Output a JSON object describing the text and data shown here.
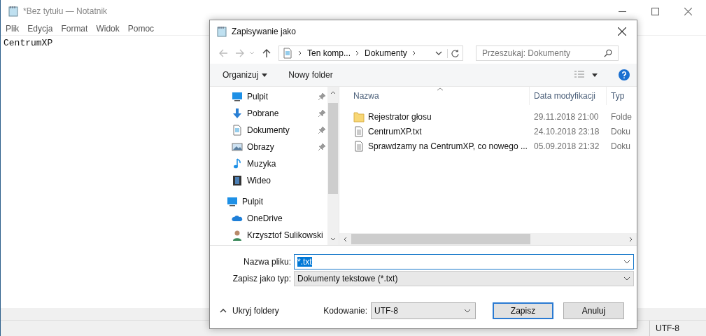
{
  "window": {
    "title": "*Bez tytułu — Notatnik"
  },
  "menu": [
    "Plik",
    "Edycja",
    "Format",
    "Widok",
    "Pomoc"
  ],
  "editor": {
    "text": "CentrumXP"
  },
  "status_bar": {
    "encoding": "UTF-8"
  },
  "dialog": {
    "title": "Zapisywanie jako",
    "breadcrumb": [
      "Ten komp...",
      "Dokumenty"
    ],
    "search": {
      "placeholder": "Przeszukaj: Dokumenty"
    },
    "toolbar": {
      "organize": "Organizuj",
      "new_folder": "Nowy folder"
    },
    "quick_access": [
      {
        "label": "Pulpit",
        "kind": "monitor",
        "pinned": true
      },
      {
        "label": "Pobrane",
        "kind": "download",
        "pinned": true
      },
      {
        "label": "Dokumenty",
        "kind": "document",
        "pinned": true
      },
      {
        "label": "Obrazy",
        "kind": "image",
        "pinned": true
      },
      {
        "label": "Muzyka",
        "kind": "music",
        "pinned": false
      },
      {
        "label": "Wideo",
        "kind": "video",
        "pinned": false
      }
    ],
    "locations": [
      {
        "label": "Pulpit",
        "kind": "monitor",
        "children": [
          {
            "label": "OneDrive",
            "kind": "cloud"
          },
          {
            "label": "Krzysztof Sulikowski",
            "kind": "user"
          }
        ]
      }
    ],
    "columns": [
      "Nazwa",
      "Data modyfikacji",
      "Typ"
    ],
    "files": [
      {
        "name": "Rejestrator głosu",
        "date": "29.11.2018 21:00",
        "type": "Folde",
        "kind": "folder"
      },
      {
        "name": "CentrumXP.txt",
        "date": "24.10.2018 23:18",
        "type": "Doku",
        "kind": "text"
      },
      {
        "name": "Sprawdzamy na CentrumXP, co nowego ...",
        "date": "05.09.2018 21:32",
        "type": "Doku",
        "kind": "text"
      }
    ],
    "filename": {
      "label": "Nazwa pliku:",
      "value": "*.txt"
    },
    "filetype": {
      "label": "Zapisz jako typ:",
      "value": "Dokumenty tekstowe (*.txt)"
    },
    "hide_folders": "Ukryj foldery",
    "encoding": {
      "label": "Kodowanie:",
      "value": "UTF-8"
    },
    "buttons": {
      "save": "Zapisz",
      "cancel": "Anuluj"
    }
  }
}
